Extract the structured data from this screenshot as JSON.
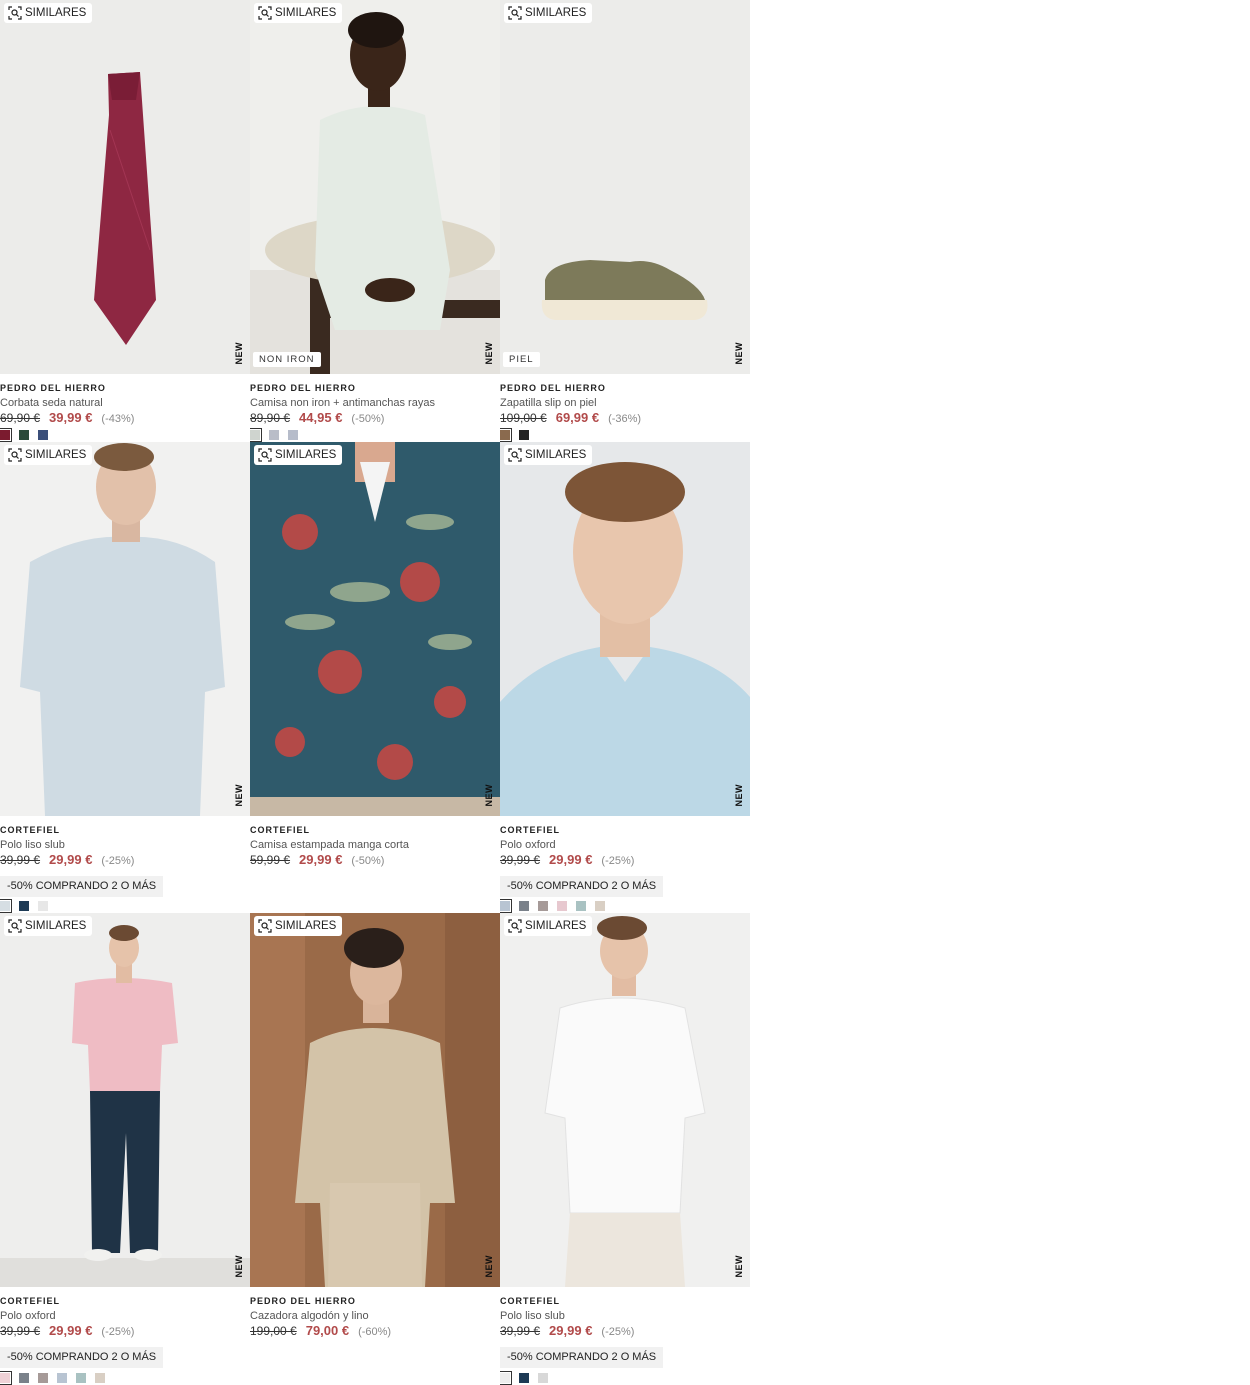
{
  "products": [
    {
      "similar_label": "SIMILARES",
      "new_label": "NEW",
      "tag": "",
      "brand": "PEDRO DEL HIERRO",
      "name": "Corbata seda natural",
      "old_price": "69,90 €",
      "price": "39,99 €",
      "discount": "(-43%)",
      "promo": "",
      "swatches": [
        "#7b1b2f",
        "#2b4a3a",
        "#3b4f7a"
      ],
      "image": "tie"
    },
    {
      "similar_label": "SIMILARES",
      "new_label": "NEW",
      "tag": "NON IRON",
      "brand": "PEDRO DEL HIERRO",
      "name": "Camisa non iron + antimanchas rayas",
      "old_price": "89,90 €",
      "price": "44,95 €",
      "discount": "(-50%)",
      "promo": "",
      "swatches": [
        "#cfd4cf",
        "#b9bdc8",
        "#b6bcca"
      ],
      "image": "shirt-seated"
    },
    {
      "similar_label": "SIMILARES",
      "new_label": "NEW",
      "tag": "PIEL",
      "brand": "PEDRO DEL HIERRO",
      "name": "Zapatilla slip on piel",
      "old_price": "109,00 €",
      "price": "69,99 €",
      "discount": "(-36%)",
      "promo": "",
      "swatches": [
        "#8a6a4e",
        "#222222"
      ],
      "image": "shoe"
    },
    {
      "similar_label": "SIMILARES",
      "new_label": "NEW",
      "tag": "",
      "brand": "CORTEFIEL",
      "name": "Polo liso slub",
      "old_price": "39,99 €",
      "price": "29,99 €",
      "discount": "(-25%)",
      "promo": "-50% COMPRANDO 2 O MÁS",
      "swatches": [
        "#d6dee3",
        "#1d3a55",
        "#e7e7e7"
      ],
      "image": "polo-light"
    },
    {
      "similar_label": "SIMILARES",
      "new_label": "NEW",
      "tag": "",
      "brand": "CORTEFIEL",
      "name": "Camisa estampada manga corta",
      "old_price": "59,99 €",
      "price": "29,99 €",
      "discount": "(-50%)",
      "promo": "",
      "swatches": [],
      "image": "floral"
    },
    {
      "similar_label": "SIMILARES",
      "new_label": "NEW",
      "tag": "",
      "brand": "CORTEFIEL",
      "name": "Polo oxford",
      "old_price": "39,99 €",
      "price": "29,99 €",
      "discount": "(-25%)",
      "promo": "-50% COMPRANDO 2 O MÁS",
      "swatches": [
        "#b8c4d2",
        "#7a818a",
        "#a69a98",
        "#e7c8cf",
        "#a9c2c2",
        "#d9cfc4"
      ],
      "image": "polo-closeup"
    },
    {
      "similar_label": "SIMILARES",
      "new_label": "NEW",
      "tag": "",
      "brand": "CORTEFIEL",
      "name": "Polo oxford",
      "old_price": "39,99 €",
      "price": "29,99 €",
      "discount": "(-25%)",
      "promo": "-50% COMPRANDO 2 O MÁS",
      "swatches": [
        "#efd1d6",
        "#7a818a",
        "#a69a98",
        "#b8c4d2",
        "#a9c2c2",
        "#d9cfc4"
      ],
      "image": "polo-pink"
    },
    {
      "similar_label": "SIMILARES",
      "new_label": "NEW",
      "tag": "",
      "brand": "PEDRO DEL HIERRO",
      "name": "Cazadora algodón y lino",
      "old_price": "199,00 €",
      "price": "79,00 €",
      "discount": "(-60%)",
      "promo": "",
      "swatches": [],
      "image": "jacket"
    },
    {
      "similar_label": "SIMILARES",
      "new_label": "NEW",
      "tag": "",
      "brand": "CORTEFIEL",
      "name": "Polo liso slub",
      "old_price": "39,99 €",
      "price": "29,99 €",
      "discount": "(-25%)",
      "promo": "-50% COMPRANDO 2 O MÁS",
      "swatches": [
        "#ededed",
        "#1d3a55",
        "#d8d8d8"
      ],
      "image": "polo-white"
    }
  ]
}
